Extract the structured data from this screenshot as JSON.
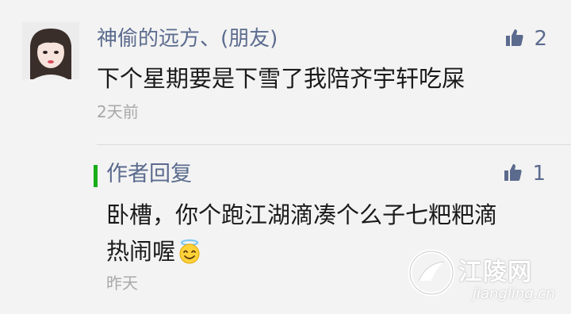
{
  "comment": {
    "author": "神偷的远方、(朋友)",
    "text": "下个星期要是下雪了我陪齐宇轩吃屎",
    "time": "2天前",
    "likes": "2"
  },
  "reply": {
    "author": "作者回复",
    "text_line1": "卧槽，你个跑江湖滴凑个么子七粑粑滴",
    "text_line2": "热闹喔",
    "time": "昨天",
    "likes": "1"
  },
  "watermark": {
    "name": "江陵网",
    "domain": "jiangling.cn"
  },
  "colors": {
    "background": "#f3f3f3",
    "link": "#5b6b8e",
    "reply_bar": "#1aad19",
    "time": "#a8a8a8"
  },
  "icons": [
    "avatar",
    "thumbs-up-icon",
    "halo-smiley-icon",
    "watermark-logo"
  ]
}
